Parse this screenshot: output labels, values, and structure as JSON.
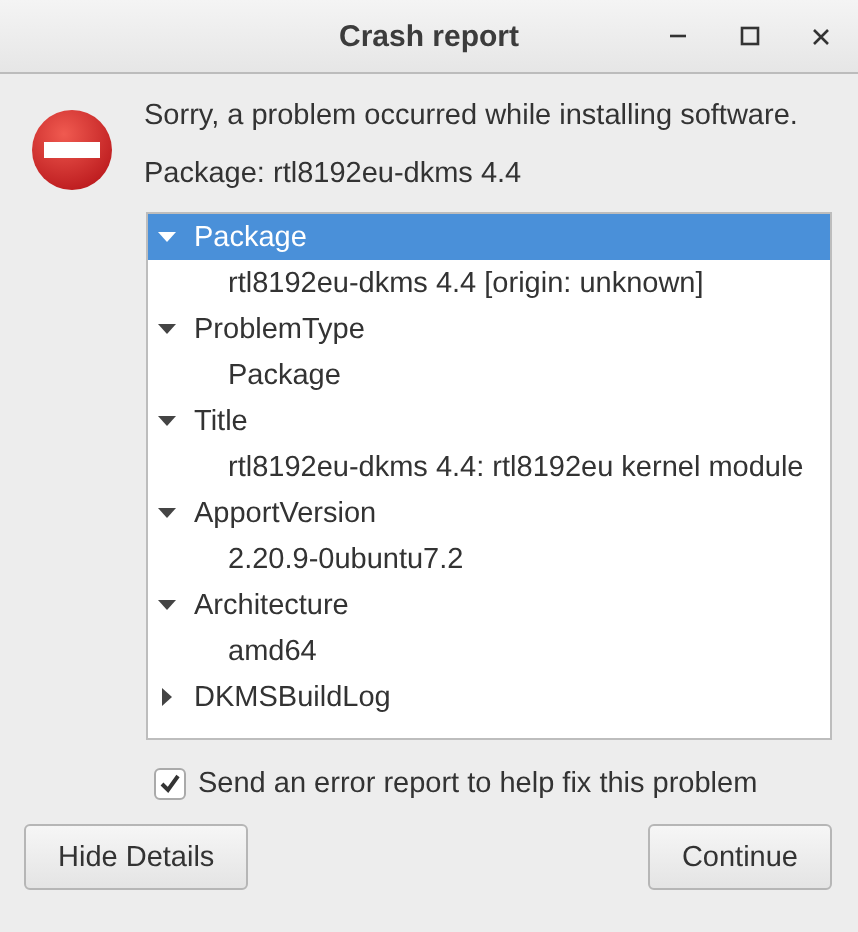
{
  "window": {
    "title": "Crash report"
  },
  "message": "Sorry, a problem occurred while installing software.",
  "package_line": "Package: rtl8192eu-dkms 4.4",
  "tree": [
    {
      "label": "Package",
      "expanded": true,
      "selected": true,
      "children": [
        {
          "label": "rtl8192eu-dkms 4.4 [origin: unknown]"
        }
      ]
    },
    {
      "label": "ProblemType",
      "expanded": true,
      "selected": false,
      "children": [
        {
          "label": "Package"
        }
      ]
    },
    {
      "label": "Title",
      "expanded": true,
      "selected": false,
      "children": [
        {
          "label": "rtl8192eu-dkms 4.4: rtl8192eu kernel module"
        }
      ]
    },
    {
      "label": "ApportVersion",
      "expanded": true,
      "selected": false,
      "children": [
        {
          "label": "2.20.9-0ubuntu7.2"
        }
      ]
    },
    {
      "label": "Architecture",
      "expanded": true,
      "selected": false,
      "children": [
        {
          "label": "amd64"
        }
      ]
    },
    {
      "label": "DKMSBuildLog",
      "expanded": false,
      "selected": false
    }
  ],
  "send_report": {
    "label": "Send an error report to help fix this problem",
    "checked": true
  },
  "buttons": [
    "Hide Details",
    "Continue"
  ]
}
